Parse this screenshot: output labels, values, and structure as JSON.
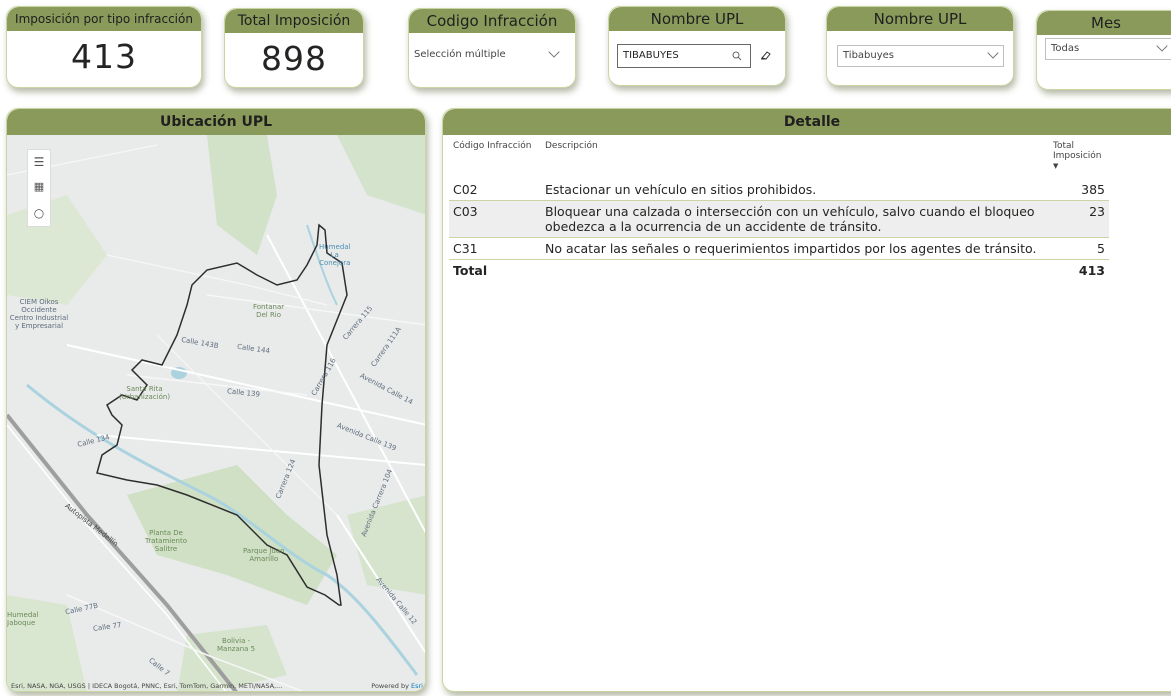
{
  "kpis": [
    {
      "title": "Imposición por tipo infracción",
      "value": "413"
    },
    {
      "title": "Total Imposición",
      "value": "898"
    }
  ],
  "slicers": {
    "codigo": {
      "title": "Codigo Infracción",
      "value": "Selección múltiple"
    },
    "upl_search": {
      "title": "Nombre UPL",
      "value": "TIBABUYES"
    },
    "upl_dropdown": {
      "title": "Nombre UPL",
      "value": "Tibabuyes"
    },
    "mes": {
      "title": "Mes",
      "value": "Todas"
    }
  },
  "map": {
    "title": "Ubicación UPL",
    "attribution": "Esri, NASA, NGA, USGS | IDECA Bogotá, PNNC, Esri, TomTom, Garmin, METI/NASA,...",
    "powered_by": "Powered by",
    "powered_brand": "Esri",
    "labels": [
      "CIEM Oikos\nOccidente\nCentro Industrial\ny Empresarial",
      "Fontanar\nDel Rio",
      "Humedal\nLa\nConejera",
      "Calle 143B",
      "Calle 144",
      "Carrera 115",
      "Carrera 111A",
      "Santa Rita\n(Urbanización)",
      "Calle 139",
      "Carrera 116",
      "Avenida Calle 14",
      "Avenida Calle 139",
      "Calle 134",
      "Autopista Medellín",
      "Carrera 124",
      "Avenida Carrera 104",
      "Planta De\nTratamiento\nSalitre",
      "Parque Juan\nAmarillo",
      "Calle 77B",
      "Calle 77",
      "Humedal\nJaboque",
      "Bolivia -\nManzana 5",
      "Avenida Calle 12",
      "Calle 7"
    ],
    "icons": [
      "menu-icon",
      "qr-icon",
      "search-icon"
    ]
  },
  "detail": {
    "title": "Detalle",
    "columns": [
      "Código Infracción",
      "Descripción",
      "Total Imposición"
    ],
    "rows": [
      {
        "code": "C02",
        "desc": "Estacionar un vehículo en sitios prohibidos.",
        "total": "385"
      },
      {
        "code": "C03",
        "desc": "Bloquear una calzada o intersección con un vehículo, salvo cuando el bloqueo obedezca a la ocurrencia de un accidente de tránsito.",
        "total": "23"
      },
      {
        "code": "C31",
        "desc": "No acatar las señales o requerimientos impartidos por los agentes de tránsito.",
        "total": "5"
      }
    ],
    "total_label": "Total",
    "total_value": "413"
  },
  "colors": {
    "header": "#8a9a5b",
    "border": "#c9d6a3",
    "map_bg": "#e9eaea",
    "park": "#c8dcc0",
    "water": "#aad3df"
  }
}
